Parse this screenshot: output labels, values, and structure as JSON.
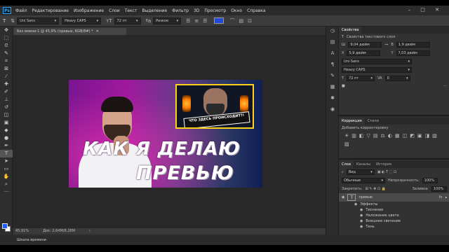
{
  "menubar": {
    "logo": "Ps",
    "items": [
      "Файл",
      "Редактирование",
      "Изображение",
      "Слои",
      "Текст",
      "Выделение",
      "Фильтр",
      "3D",
      "Просмотр",
      "Окно",
      "Справка"
    ],
    "window_controls": "– □ ✕"
  },
  "options_bar": {
    "tool_icon": "T",
    "font_family": "Uni Sans",
    "font_style": "Heavy CAPS",
    "font_size": "72 пт",
    "antialias": "Резкое",
    "text_color": "#2449d8"
  },
  "document": {
    "tab_title": "Без имени-1 @ 45,9% (превью, RGB/8#) *",
    "zoom": "45,91%",
    "doc_info": "Док: 2,64M/8,28M"
  },
  "canvas": {
    "headline_line1": "КАК Я ДЕЛАЮ",
    "headline_line2": "ПРЕВЬЮ",
    "thumb_banner": "ЧТО ЗДЕСЬ ПРОИСХОДИТ?!"
  },
  "timeline": {
    "label": "Шкала времени"
  },
  "properties_panel": {
    "tab": "Свойства",
    "subtitle": "Свойства текстового слоя",
    "w_label": "Ш",
    "w_value": "9,04 дюйм",
    "h_label": "В",
    "h_value": "1,9 дюйм",
    "x_label": "X",
    "x_value": "5,9 дюйм",
    "y_label": "Y",
    "y_value": "7,03 дюйм",
    "font_family": "Uni Sans",
    "font_style": "Heavy CAPS",
    "font_size": "72 пт",
    "tracking": "0"
  },
  "adjustments_panel": {
    "tabs": [
      "Коррекция",
      "Стили"
    ],
    "hint": "Добавить корректировку",
    "icons": [
      "☀",
      "▥",
      "◧",
      "▽",
      "▤",
      "⚖",
      "◐",
      "▦",
      "◫",
      "◩",
      "▣",
      "◨",
      "▧",
      "▨"
    ]
  },
  "layers_panel": {
    "tabs": [
      "Слои",
      "Каналы",
      "История"
    ],
    "filter_label": "Вид",
    "blend_mode": "Обычные",
    "opacity_label": "Непрозрачность:",
    "opacity_value": "100%",
    "lock_label": "Закрепить:",
    "fill_label": "Заливка:",
    "fill_value": "100%",
    "layers": [
      {
        "name": "превью",
        "type": "T",
        "fx": "fx"
      },
      {
        "name": "Эффекты"
      },
      {
        "name": "Тиснение"
      },
      {
        "name": "Наложение цвета"
      },
      {
        "name": "Внешнее свечение"
      },
      {
        "name": "Тень"
      }
    ]
  },
  "colors": {
    "foreground": "#1f5cff",
    "background": "#ffffff",
    "headline_color": "#ffffff",
    "thumb_border": "#ffd21a"
  }
}
